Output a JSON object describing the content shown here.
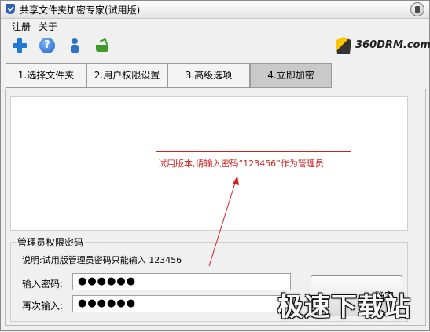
{
  "window": {
    "title": "共享文件夹加密专家(试用版)"
  },
  "menu": {
    "items": [
      "注册",
      "关于"
    ]
  },
  "toolbar": {
    "icons": [
      "add-icon",
      "help-icon",
      "user-icon",
      "basket-icon"
    ],
    "help_glyph": "?"
  },
  "logo": {
    "text": "360DRM.com"
  },
  "tabs": [
    "1.选择文件夹",
    "2.用户权限设置",
    "3.高级选项",
    "4.立即加密"
  ],
  "active_tab": 3,
  "annotation": {
    "text": "试用版本,请输入密码“123456”作为管理员",
    "color": "#d32020"
  },
  "admin": {
    "group_title": "管理员权限密码",
    "note": "说明:试用版管理员密码只能输入  123456",
    "password_label": "输入密码:",
    "password_value": "●●●●●●",
    "confirm_label": "再次输入:",
    "confirm_value": "●●●●●●",
    "button_label": "确定"
  },
  "watermark": "极速下载站"
}
